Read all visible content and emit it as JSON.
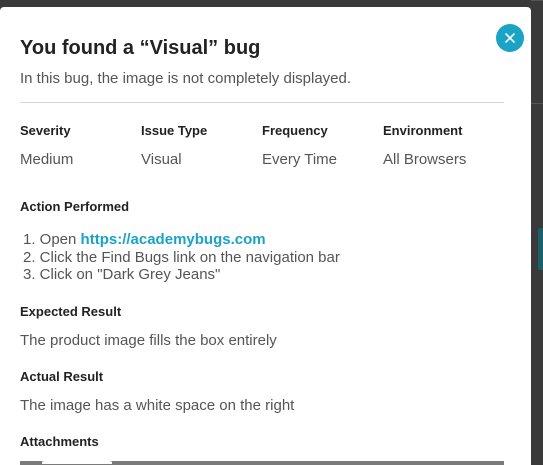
{
  "modal": {
    "title": "You found a “Visual” bug",
    "subtitle": "In this bug, the image is not completely displayed.",
    "close_icon": "close-icon"
  },
  "details": [
    {
      "label": "Severity",
      "value": "Medium"
    },
    {
      "label": "Issue Type",
      "value": "Visual"
    },
    {
      "label": "Frequency",
      "value": "Every Time"
    },
    {
      "label": "Environment",
      "value": "All Browsers"
    }
  ],
  "action": {
    "label": "Action Performed",
    "steps": [
      {
        "prefix": "1. Open ",
        "link": "https://academybugs.com"
      },
      {
        "text": "2. Click the Find Bugs link on the navigation bar"
      },
      {
        "text": "3. Click on \"Dark Grey Jeans\""
      }
    ]
  },
  "expected": {
    "label": "Expected Result",
    "text": "The product image fills the box entirely"
  },
  "actual": {
    "label": "Actual Result",
    "text": "The image has a white space on the right"
  },
  "attachments": {
    "label": "Attachments"
  },
  "colors": {
    "accent": "#1ba3c6",
    "backdrop": "#3a3a3a"
  }
}
